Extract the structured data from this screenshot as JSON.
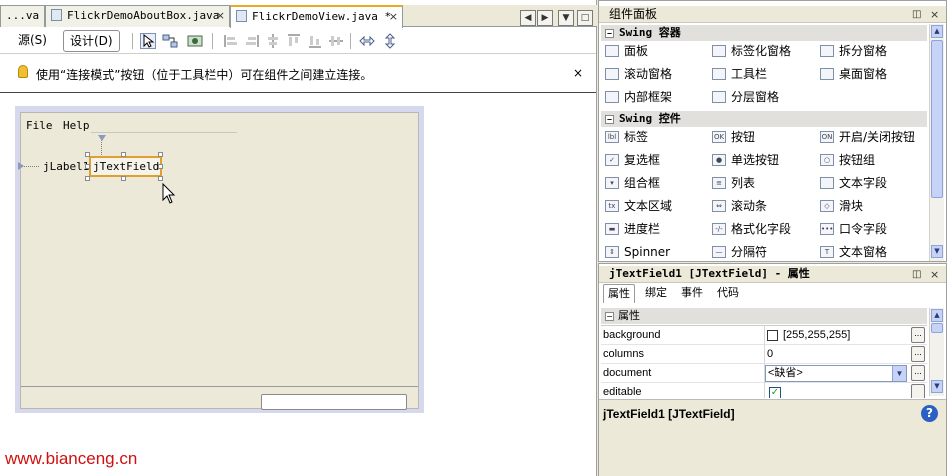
{
  "tabs": [
    {
      "label": "...va",
      "close": "×"
    },
    {
      "label": "FlickrDemoAboutBox.java",
      "close": "×"
    },
    {
      "label": "FlickrDemoView.java *",
      "close": "×"
    }
  ],
  "toolbar": {
    "source_label": "源(S)",
    "design_label": "设计(D)"
  },
  "hint": {
    "text": "使用“连接模式”按钮（位于工具栏中）可在组件之间建立连接。",
    "close": "×"
  },
  "form": {
    "menu": [
      "File",
      "Help"
    ],
    "label_text": "jLabel1",
    "textfield_text": "jTextField1"
  },
  "palette": {
    "title": "组件面板",
    "close": "×",
    "categories": [
      {
        "name": "Swing 容器",
        "items": [
          {
            "label": "面板",
            "icon": "panel-icon"
          },
          {
            "label": "标签化窗格",
            "icon": "tabbed-pane-icon"
          },
          {
            "label": "拆分窗格",
            "icon": "split-pane-icon"
          },
          {
            "label": "滚动窗格",
            "icon": "scroll-pane-icon"
          },
          {
            "label": "工具栏",
            "icon": "toolbar-icon"
          },
          {
            "label": "桌面窗格",
            "icon": "desktop-pane-icon"
          },
          {
            "label": "内部框架",
            "icon": "internal-frame-icon"
          },
          {
            "label": "分层窗格",
            "icon": "layered-pane-icon"
          }
        ]
      },
      {
        "name": "Swing 控件",
        "items": [
          {
            "label": "标签",
            "icon": "label-icon"
          },
          {
            "label": "按钮",
            "icon": "button-icon"
          },
          {
            "label": "开启/关闭按钮",
            "icon": "toggle-button-icon"
          },
          {
            "label": "复选框",
            "icon": "checkbox-icon"
          },
          {
            "label": "单选按钮",
            "icon": "radio-button-icon"
          },
          {
            "label": "按钮组",
            "icon": "button-group-icon"
          },
          {
            "label": "组合框",
            "icon": "combo-box-icon"
          },
          {
            "label": "列表",
            "icon": "list-icon"
          },
          {
            "label": "文本字段",
            "icon": "text-field-icon"
          },
          {
            "label": "文本区域",
            "icon": "text-area-icon"
          },
          {
            "label": "滚动条",
            "icon": "scroll-bar-icon"
          },
          {
            "label": "滑块",
            "icon": "slider-icon"
          },
          {
            "label": "进度栏",
            "icon": "progress-bar-icon"
          },
          {
            "label": "格式化字段",
            "icon": "formatted-field-icon"
          },
          {
            "label": "口令字段",
            "icon": "password-field-icon"
          },
          {
            "label": "Spinner",
            "icon": "spinner-icon"
          },
          {
            "label": "分隔符",
            "icon": "separator-icon"
          },
          {
            "label": "文本窗格",
            "icon": "text-pane-icon"
          }
        ]
      }
    ]
  },
  "properties": {
    "title": "jTextField1 [JTextField] - 属性",
    "close": "×",
    "tabs": [
      "属性",
      "绑定",
      "事件",
      "代码"
    ],
    "section": "属性",
    "rows": [
      {
        "name": "background",
        "value": "[255,255,255]"
      },
      {
        "name": "columns",
        "value": "0"
      },
      {
        "name": "document",
        "value": "<缺省>"
      },
      {
        "name": "editable",
        "value": ""
      }
    ],
    "description": "jTextField1 [JTextField]",
    "help": "?"
  },
  "watermark": "www.bianceng.cn",
  "colors": {
    "accent_tab": "#e8a828",
    "canvas_frame": "#d6d8ee",
    "watermark": "#d01010",
    "selection": "#e0a030"
  }
}
